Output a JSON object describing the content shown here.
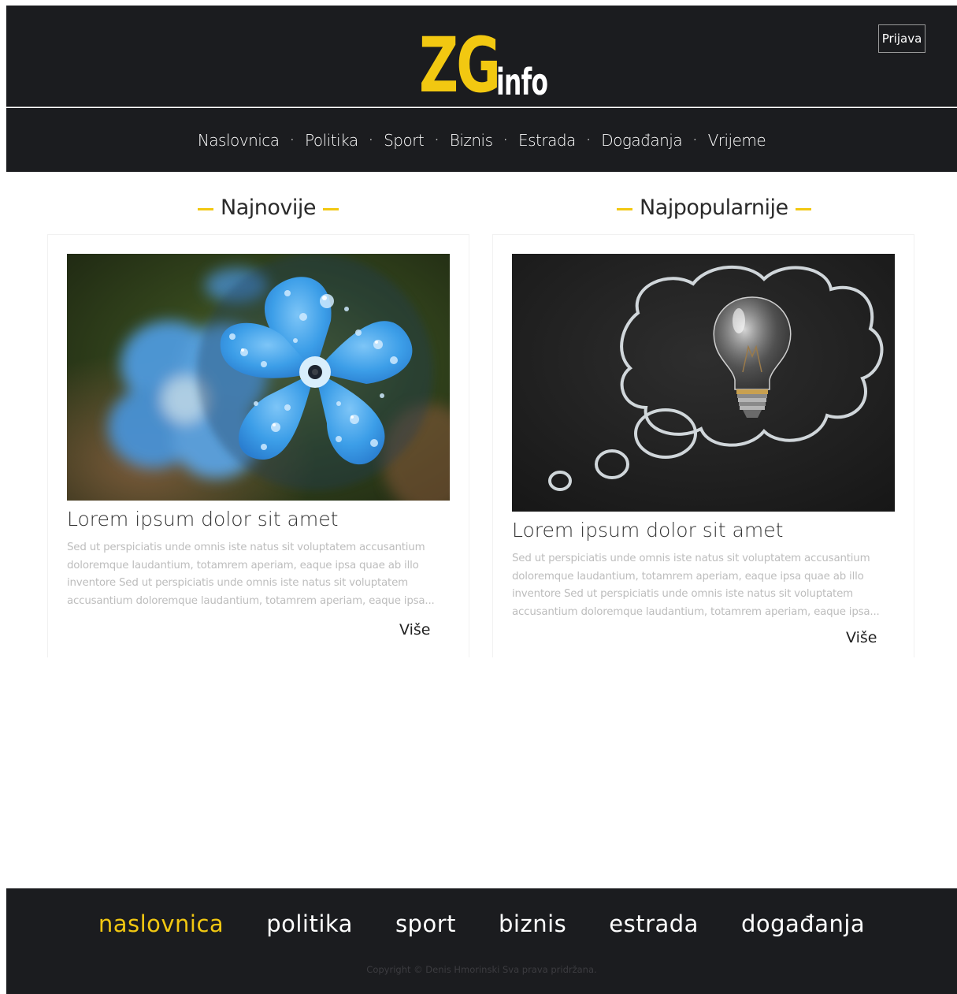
{
  "header": {
    "logo_main": "ZG",
    "logo_sub": "info",
    "login_label": "Prijava"
  },
  "nav": {
    "items": [
      "Naslovnica",
      "Politika",
      "Sport",
      "Biznis",
      "Estrada",
      "Događanja",
      "Vrijeme"
    ],
    "separator": "·"
  },
  "sections": {
    "latest": {
      "title": "Najnovije",
      "card": {
        "image_subject": "blue-flower-photo",
        "headline": "Lorem ipsum dolor sit amet",
        "excerpt": "Sed ut perspiciatis unde omnis iste natus sit voluptatem accusantium doloremque laudantium, totamrem aperiam, eaque ipsa quae ab illo inventore Sed ut perspiciatis unde omnis iste natus sit voluptatem accusantium doloremque laudantium, totamrem aperiam, eaque ipsa...",
        "more_label": "Više"
      }
    },
    "popular": {
      "title": "Najpopularnije",
      "card": {
        "image_subject": "lightbulb-chalk-cloud-photo",
        "headline": "Lorem ipsum dolor sit amet",
        "excerpt": "Sed ut perspiciatis unde omnis iste natus sit voluptatem accusantium doloremque laudantium, totamrem aperiam, eaque ipsa quae ab illo inventore Sed ut perspiciatis unde omnis iste natus sit voluptatem accusantium doloremque laudantium, totamrem aperiam, eaque ipsa...",
        "more_label": "Više"
      }
    }
  },
  "footer": {
    "links": [
      "naslovnica",
      "politika",
      "sport",
      "biznis",
      "estrada",
      "događanja"
    ],
    "active_index": 0,
    "copyright": "Copyright © Denis Hmorinski Sva prava pridržana."
  },
  "colors": {
    "accent": "#f2c811",
    "dark_bg": "#1b1c1f",
    "muted_text": "#bdbdbd"
  }
}
